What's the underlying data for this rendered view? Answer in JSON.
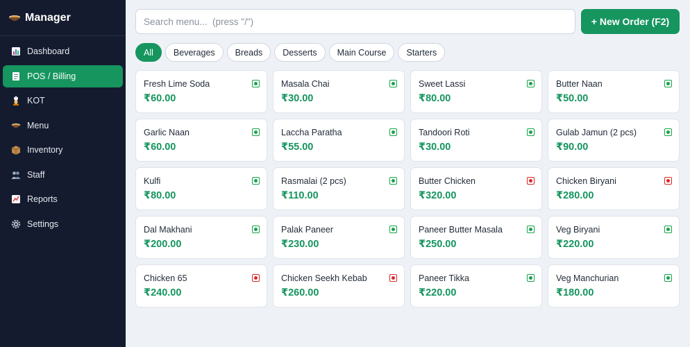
{
  "app": {
    "title": "Manager",
    "logo_icon": "bowl-icon"
  },
  "sidebar": {
    "items": [
      {
        "label": "Dashboard",
        "icon": "bar-chart-icon",
        "active": false
      },
      {
        "label": "POS / Billing",
        "icon": "receipt-icon",
        "active": true
      },
      {
        "label": "KOT",
        "icon": "chef-icon",
        "active": false
      },
      {
        "label": "Menu",
        "icon": "bowl-icon",
        "active": false
      },
      {
        "label": "Inventory",
        "icon": "box-icon",
        "active": false
      },
      {
        "label": "Staff",
        "icon": "people-icon",
        "active": false
      },
      {
        "label": "Reports",
        "icon": "line-chart-icon",
        "active": false
      },
      {
        "label": "Settings",
        "icon": "gear-icon",
        "active": false
      }
    ]
  },
  "search": {
    "placeholder": "Search menu...  (press \"/\")",
    "value": ""
  },
  "new_order_label": "+ New Order (F2)",
  "filters": [
    {
      "label": "All",
      "active": true
    },
    {
      "label": "Beverages",
      "active": false
    },
    {
      "label": "Breads",
      "active": false
    },
    {
      "label": "Desserts",
      "active": false
    },
    {
      "label": "Main Course",
      "active": false
    },
    {
      "label": "Starters",
      "active": false
    }
  ],
  "menu_items": [
    {
      "name": "Fresh Lime Soda",
      "price": "₹60.00",
      "veg": true
    },
    {
      "name": "Masala Chai",
      "price": "₹30.00",
      "veg": true
    },
    {
      "name": "Sweet Lassi",
      "price": "₹80.00",
      "veg": true
    },
    {
      "name": "Butter Naan",
      "price": "₹50.00",
      "veg": true
    },
    {
      "name": "Garlic Naan",
      "price": "₹60.00",
      "veg": true
    },
    {
      "name": "Laccha Paratha",
      "price": "₹55.00",
      "veg": true
    },
    {
      "name": "Tandoori Roti",
      "price": "₹30.00",
      "veg": true
    },
    {
      "name": "Gulab Jamun (2 pcs)",
      "price": "₹90.00",
      "veg": true
    },
    {
      "name": "Kulfi",
      "price": "₹80.00",
      "veg": true
    },
    {
      "name": "Rasmalai (2 pcs)",
      "price": "₹110.00",
      "veg": true
    },
    {
      "name": "Butter Chicken",
      "price": "₹320.00",
      "veg": false
    },
    {
      "name": "Chicken Biryani",
      "price": "₹280.00",
      "veg": false
    },
    {
      "name": "Dal Makhani",
      "price": "₹200.00",
      "veg": true
    },
    {
      "name": "Palak Paneer",
      "price": "₹230.00",
      "veg": true
    },
    {
      "name": "Paneer Butter Masala",
      "price": "₹250.00",
      "veg": true
    },
    {
      "name": "Veg Biryani",
      "price": "₹220.00",
      "veg": true
    },
    {
      "name": "Chicken 65",
      "price": "₹240.00",
      "veg": false
    },
    {
      "name": "Chicken Seekh Kebab",
      "price": "₹260.00",
      "veg": false
    },
    {
      "name": "Paneer Tikka",
      "price": "₹220.00",
      "veg": true
    },
    {
      "name": "Veg Manchurian",
      "price": "₹180.00",
      "veg": true
    }
  ],
  "colors": {
    "accent": "#16955f",
    "sidebar_bg": "#141b2e",
    "veg": "#16a34a",
    "nonveg": "#dc2626",
    "page_bg": "#eef1f6"
  }
}
